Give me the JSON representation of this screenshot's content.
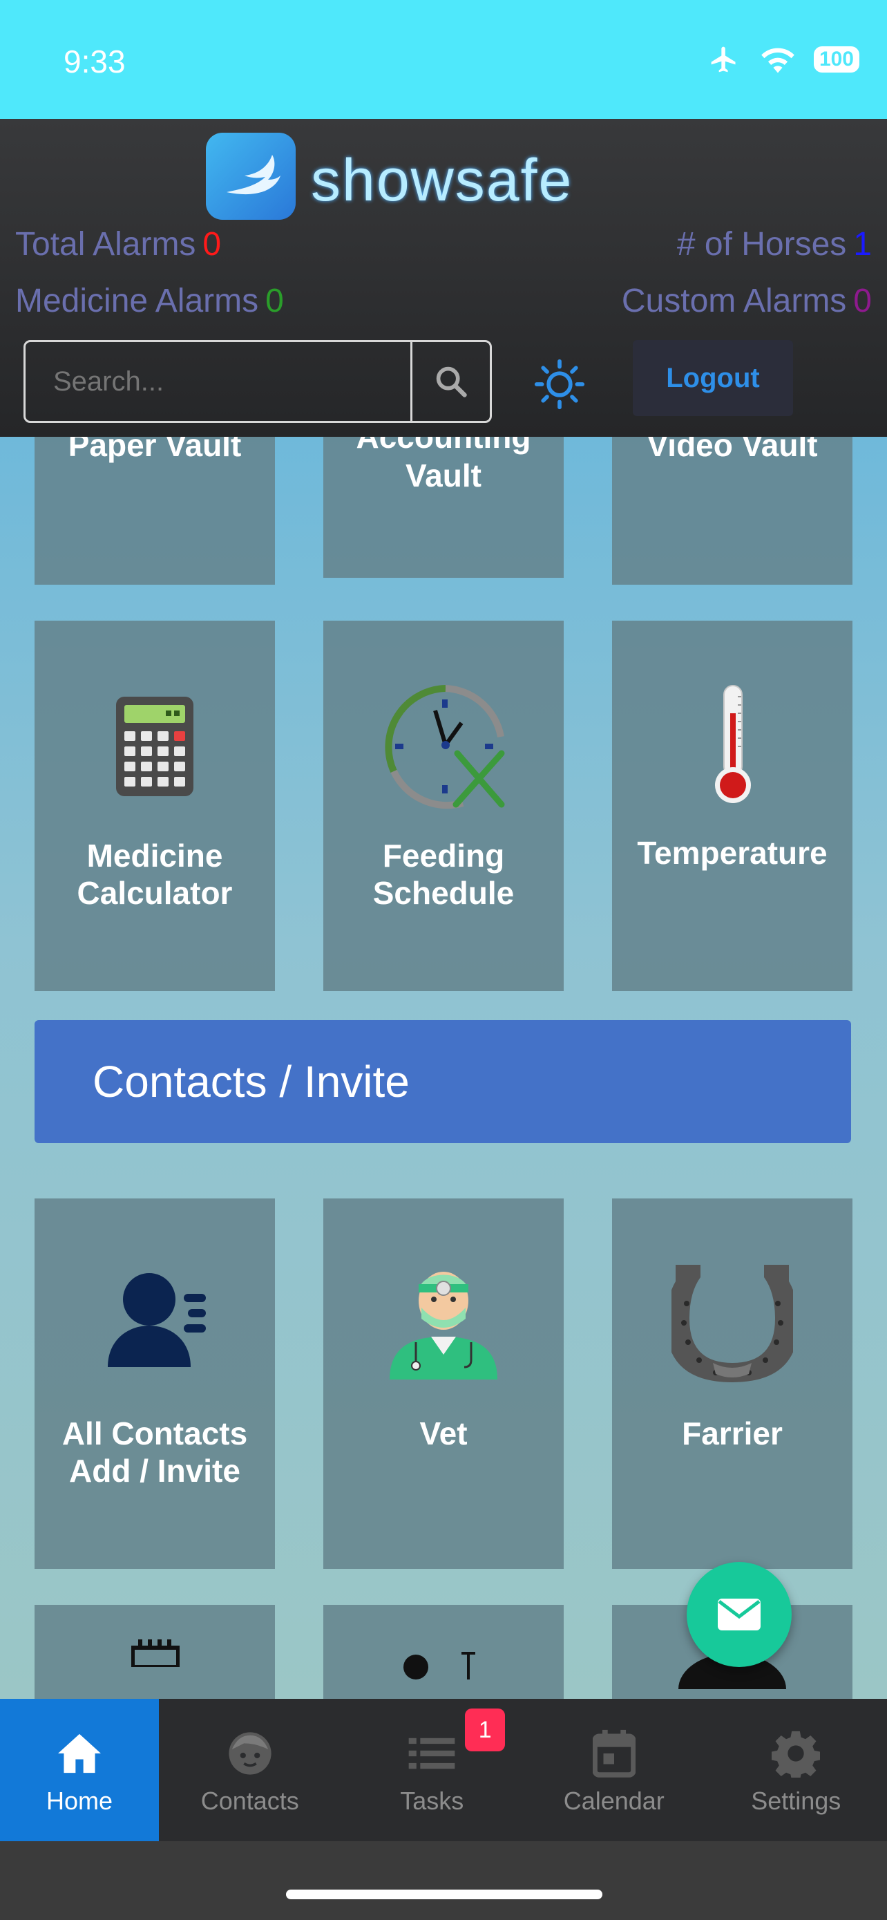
{
  "status_bar": {
    "time": "9:33",
    "battery": "100"
  },
  "header": {
    "brand": "showsafe",
    "stats": {
      "total_alarms_label": "Total Alarms",
      "total_alarms_value": "0",
      "horses_label": "# of Horses",
      "horses_value": "1",
      "medicine_alarms_label": "Medicine Alarms",
      "medicine_alarms_value": "0",
      "custom_alarms_label": "Custom Alarms",
      "custom_alarms_value": "0"
    },
    "search_placeholder": "Search...",
    "logout_label": "Logout"
  },
  "colors": {
    "zero_red": "#ff1a1a",
    "horse_blue": "#1a1aff",
    "med_green": "#2a9d2a",
    "custom_purple": "#8e1a8e"
  },
  "tiles_row1": [
    "Paper Vault",
    "Accounting Vault",
    "Video Vault"
  ],
  "tiles_row2": {
    "medicine": [
      "Medicine",
      "Calculator"
    ],
    "feeding": [
      "Feeding",
      "Schedule"
    ],
    "temperature": "Temperature"
  },
  "section": {
    "contacts_invite": "Contacts / Invite"
  },
  "tiles_row3": {
    "all_contacts": [
      "All Contacts",
      "Add / Invite"
    ],
    "vet": "Vet",
    "farrier": "Farrier"
  },
  "icons": [
    "calculator-icon",
    "clock-fork-icon",
    "thermometer-icon",
    "contact-icon",
    "vet-icon",
    "horseshoe-icon",
    "mail-icon",
    "home-icon",
    "contacts-face-icon",
    "tasks-list-icon",
    "calendar-icon",
    "gear-icon"
  ],
  "tabbar": {
    "home": "Home",
    "contacts": "Contacts",
    "tasks": "Tasks",
    "tasks_badge": "1",
    "calendar": "Calendar",
    "settings": "Settings"
  }
}
